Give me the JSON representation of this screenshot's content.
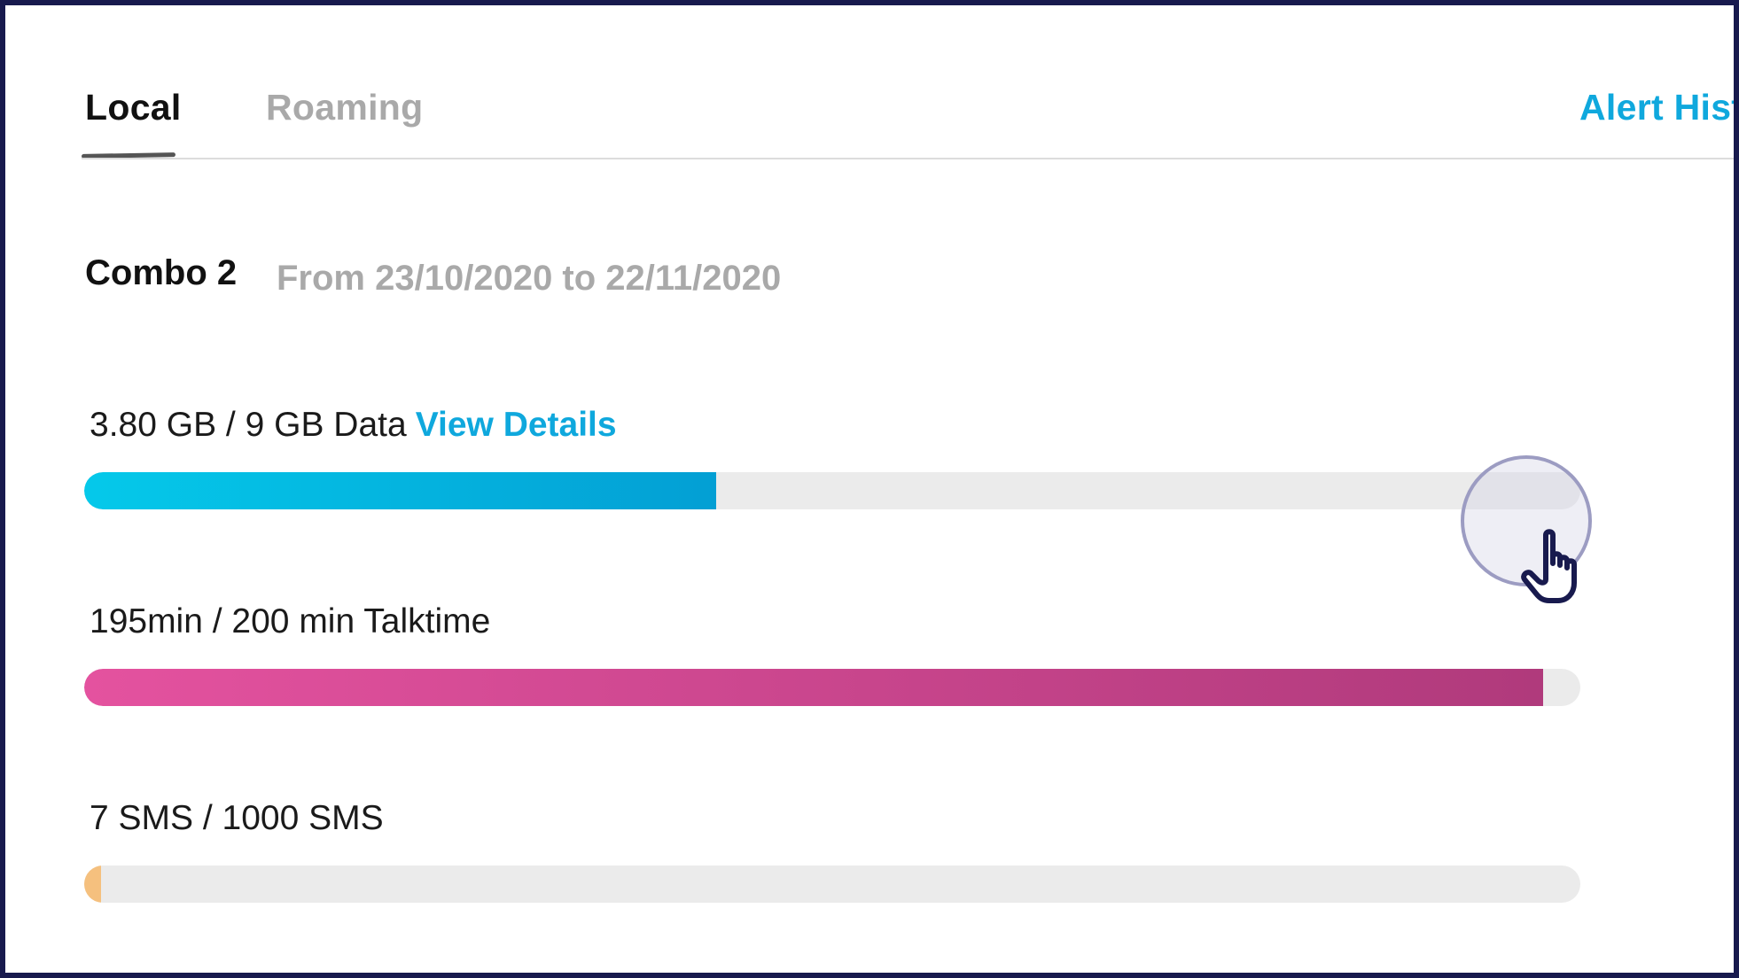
{
  "tabs": {
    "local": "Local",
    "roaming": "Roaming",
    "alert_history": "Alert Hist"
  },
  "plan": {
    "name": "Combo 2",
    "period": "From 23/10/2020 to 22/11/2020"
  },
  "usage": [
    {
      "label": "3.80 GB / 9 GB Data",
      "link": "View Details",
      "used": 3.8,
      "total": 9,
      "color_start": "#05c9ea",
      "color_end": "#039fd4"
    },
    {
      "label": "195min / 200 min Talktime",
      "used": 195,
      "total": 200,
      "color_start": "#e4529f",
      "color_end": "#b03a7c"
    },
    {
      "label": "7 SMS / 1000 SMS",
      "used": 7,
      "total": 1000,
      "color_start": "#f5c07e",
      "color_end": "#f5c07e"
    }
  ],
  "colors": {
    "accent": "#0fa8dd",
    "frame": "#181a4e",
    "track": "#ebebeb"
  },
  "icons": {
    "cursor": "hand-pointer-icon"
  }
}
